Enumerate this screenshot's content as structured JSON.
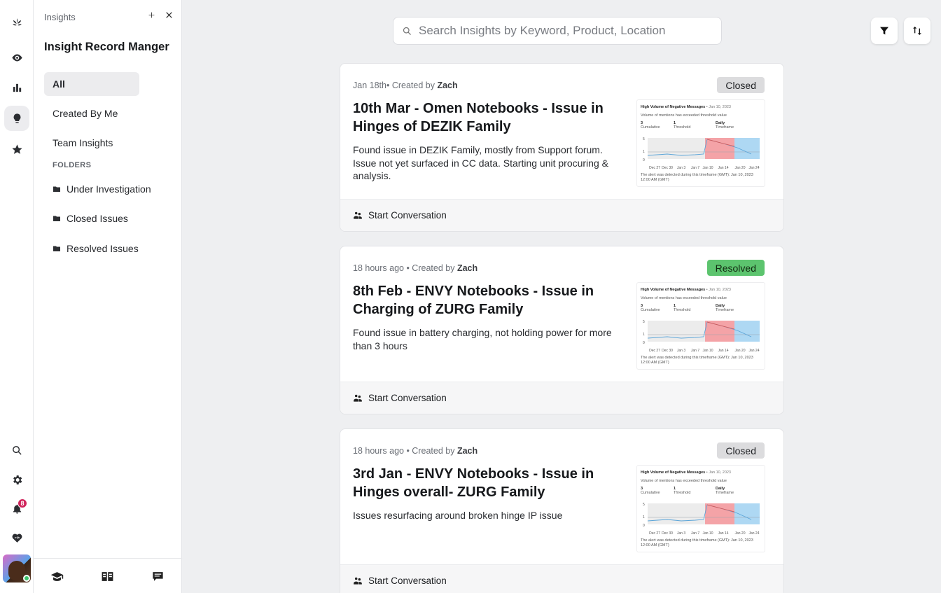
{
  "rail": {
    "notifications_count": "8"
  },
  "panel": {
    "header": "Insights",
    "title": "Insight Record Manger",
    "nav": [
      "All",
      "Created By Me",
      "Team Insights"
    ],
    "folders_heading": "FOLDERS",
    "folders": [
      "Under Investigation",
      "Closed Issues",
      "Resolved Issues"
    ]
  },
  "search": {
    "placeholder": "Search Insights by Keyword, Product, Location"
  },
  "cards": [
    {
      "time": "Jan 18th",
      "sep": "• Created by ",
      "author": "Zach",
      "status": "Closed",
      "title": "10th Mar - Omen Notebooks - Issue in Hinges of DEZIK Family",
      "desc": "Found issue in DEZIK Family, mostly from Support forum. Issue not yet surfaced in CC data. Starting unit procuring & analysis.",
      "action": "Start Conversation"
    },
    {
      "time": "18 hours ago",
      "sep": " • Created by ",
      "author": "Zach",
      "status": "Resolved",
      "title": "8th Feb - ENVY Notebooks - Issue in Charging of ZURG Family",
      "desc": "Found issue in battery charging, not holding power for more than 3 hours",
      "action": "Start Conversation"
    },
    {
      "time": "18 hours ago",
      "sep": " • Created by ",
      "author": "Zach",
      "status": "Closed",
      "title": "3rd Jan - ENVY Notebooks - Issue in Hinges overall- ZURG Family",
      "desc": "Issues resurfacing around broken hinge IP issue",
      "action": "Start Conversation"
    }
  ],
  "mini_chart": {
    "title": "High Volume of Negative Messages",
    "date": "• Jan 10, 2023",
    "subtitle": "Volume of mentions has exceeded threshold value",
    "cumulative_value": "3",
    "cumulative_label": "Cumulative",
    "threshold_value": "1",
    "threshold_label": "Threshold",
    "timeframe_value": "Daily",
    "timeframe_label": "Timeframe",
    "footer": "The alert was detected during this timeframe (GMT): Jan 10, 2023 12:00 AM (GMT)",
    "yticks": [
      "5",
      "1",
      "0"
    ],
    "xticks": [
      "Dec 27",
      "Dec 30",
      "Jan 3",
      "Jan 7",
      "Jan 10",
      "Jan 14",
      "Jan 20",
      "Jan 24"
    ]
  },
  "colors": {
    "resolved": "#5cc46e",
    "closed": "#dcdcde",
    "alert": "#f4a3a7",
    "after": "#aed8f3"
  }
}
